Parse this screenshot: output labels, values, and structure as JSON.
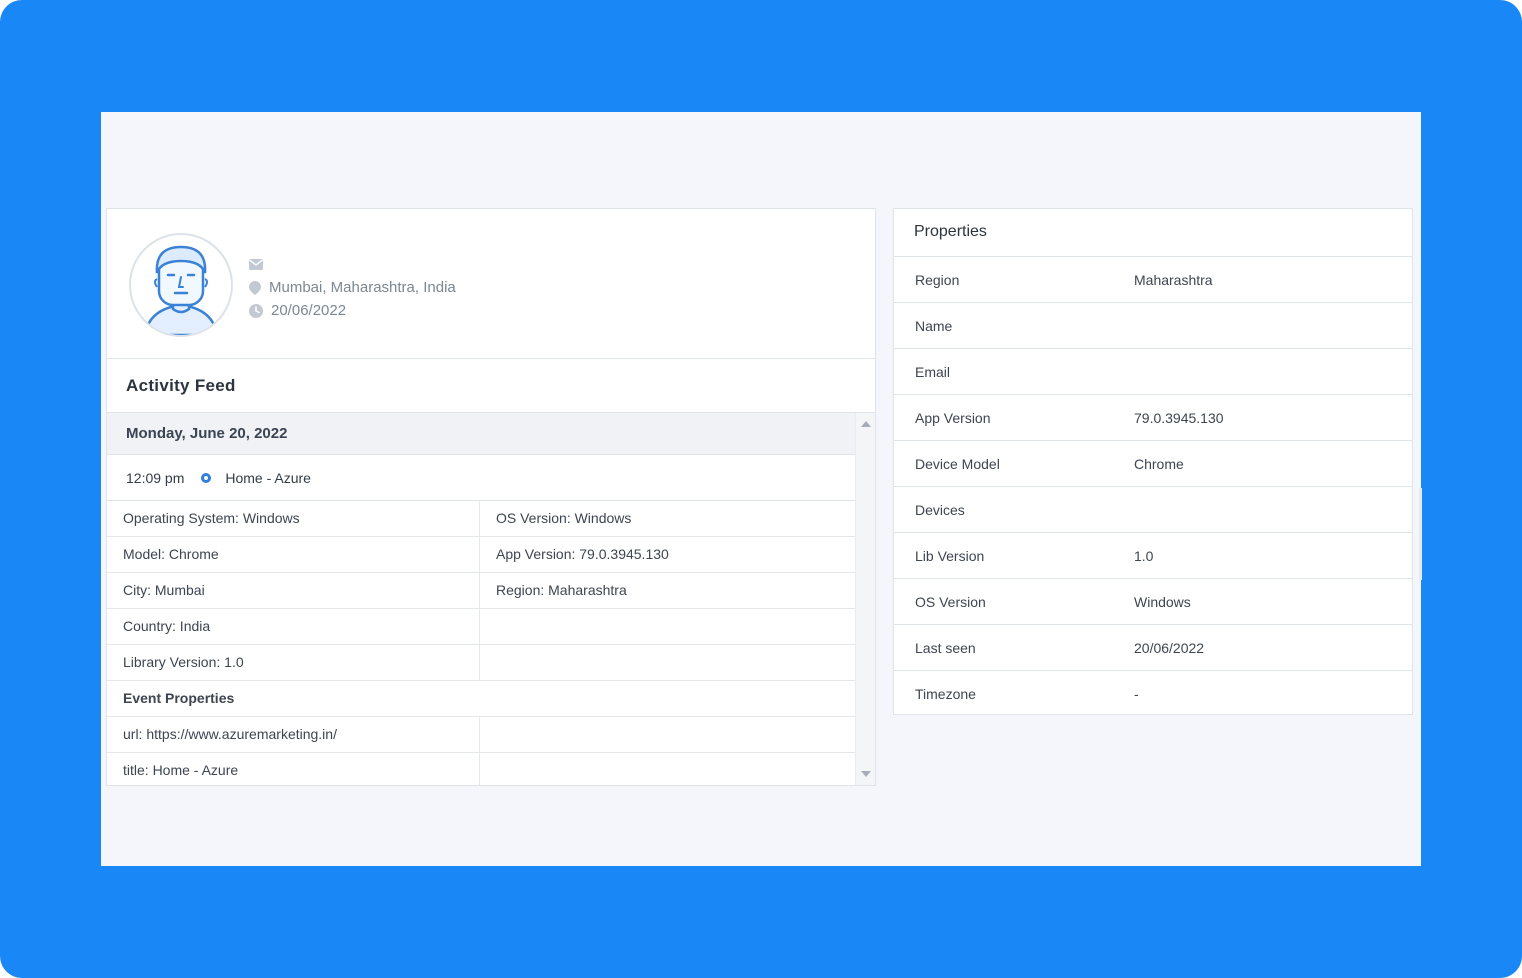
{
  "profile": {
    "email": "",
    "location": "Mumbai, Maharashtra, India",
    "date": "20/06/2022"
  },
  "activity_feed": {
    "title": "Activity Feed",
    "date_header": "Monday, June 20, 2022",
    "event": {
      "time": "12:09 pm",
      "name": "Home - Azure"
    },
    "details": [
      [
        "Operating System: Windows",
        "OS Version: Windows"
      ],
      [
        "Model: Chrome",
        "App Version: 79.0.3945.130"
      ],
      [
        "City: Mumbai",
        "Region: Maharashtra"
      ],
      [
        "Country: India",
        ""
      ],
      [
        "Library Version: 1.0",
        ""
      ]
    ],
    "event_properties_label": "Event Properties",
    "event_properties": [
      [
        "url: https://www.azuremarketing.in/",
        ""
      ],
      [
        "title: Home - Azure",
        ""
      ]
    ]
  },
  "properties": {
    "title": "Properties",
    "rows": [
      {
        "key": "Region",
        "value": "Maharashtra"
      },
      {
        "key": "Name",
        "value": ""
      },
      {
        "key": "Email",
        "value": ""
      },
      {
        "key": "App Version",
        "value": "79.0.3945.130"
      },
      {
        "key": "Device Model",
        "value": "Chrome"
      },
      {
        "key": "Devices",
        "value": ""
      },
      {
        "key": "Lib Version",
        "value": "1.0"
      },
      {
        "key": "OS Version",
        "value": "Windows"
      },
      {
        "key": "Last seen",
        "value": "20/06/2022"
      },
      {
        "key": "Timezone",
        "value": "-"
      }
    ]
  },
  "colors": {
    "frame": "#1a87f7",
    "accent": "#2f7fe0",
    "background": "#f4f6fb"
  },
  "icons": {
    "avatar": "user-avatar-icon",
    "email": "envelope-icon",
    "location": "map-pin-icon",
    "date": "clock-icon",
    "event": "event-dot-icon"
  }
}
